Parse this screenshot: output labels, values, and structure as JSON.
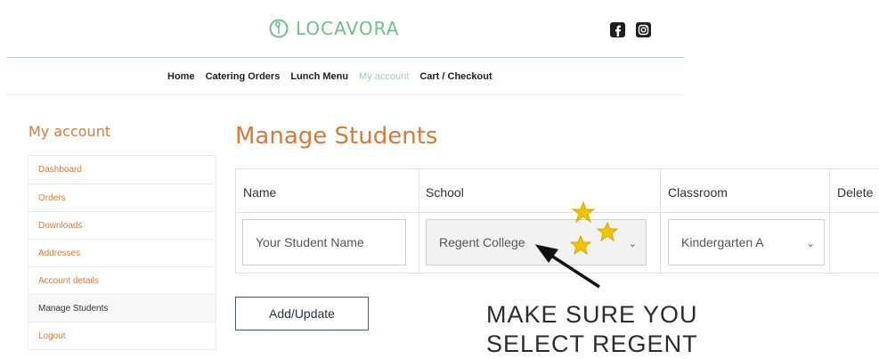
{
  "header": {
    "logo_text": "LOCAVORA",
    "social_icons": [
      "facebook-icon",
      "instagram-icon"
    ],
    "nav": [
      "Home",
      "Catering Orders",
      "Lunch Menu",
      "My account",
      "Cart / Checkout"
    ],
    "active_nav": "My account"
  },
  "sidebar": {
    "title": "My account",
    "items": [
      {
        "label": "Dashboard"
      },
      {
        "label": "Orders"
      },
      {
        "label": "Downloads"
      },
      {
        "label": "Addresses"
      },
      {
        "label": "Account details"
      },
      {
        "label": "Manage Students"
      },
      {
        "label": "Logout"
      }
    ],
    "current": "Manage Students"
  },
  "main": {
    "title": "Manage Students",
    "columns": [
      "Name",
      "School",
      "Classroom",
      "Delete"
    ],
    "row": {
      "name_placeholder": "Your Student Name",
      "school": "Regent College",
      "classroom": "Kindergarten A"
    },
    "button": "Add/Update"
  },
  "annotation": {
    "text_line1": "MAKE SURE YOU",
    "text_line2": "SELECT REGENT",
    "star_color": "#f2c400",
    "arrow_color": "#111111"
  },
  "colors": {
    "accent_orange": "#d77a3b",
    "brand_green": "#6fbf8f"
  }
}
